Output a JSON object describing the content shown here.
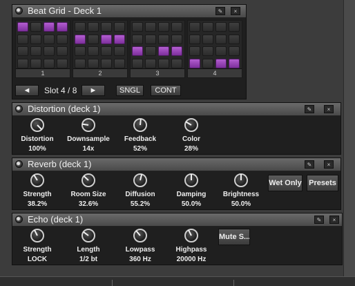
{
  "beat_grid": {
    "title": "Beat Grid - Deck 1",
    "groups": [
      {
        "label": "1",
        "active_rows": [
          0,
          0,
          0,
          0
        ]
      },
      {
        "label": "2",
        "active_rows": [
          1,
          1,
          1,
          1
        ]
      },
      {
        "label": "3",
        "active_rows": [
          2,
          2,
          2,
          2
        ]
      },
      {
        "label": "4",
        "active_rows": [
          3,
          3,
          3,
          3
        ]
      }
    ],
    "active_cells": [
      [
        0,
        0
      ],
      [
        2,
        0
      ],
      [
        3,
        0
      ],
      [
        4,
        1
      ],
      [
        6,
        1
      ],
      [
        7,
        1
      ],
      [
        8,
        2
      ],
      [
        10,
        2
      ],
      [
        11,
        2
      ],
      [
        12,
        3
      ],
      [
        14,
        3
      ],
      [
        15,
        3
      ]
    ],
    "prev_label": "◄",
    "slot_label": "Slot 4 / 8",
    "next_label": "►",
    "sngl_label": "SNGL",
    "cont_label": "CONT"
  },
  "distortion": {
    "title": "Distortion (deck 1)",
    "knobs": [
      {
        "name": "Distortion",
        "value": "100%",
        "level": 1.0
      },
      {
        "name": "Downsample",
        "value": "14x",
        "level": 0.2
      },
      {
        "name": "Feedback",
        "value": "52%",
        "level": 0.52
      },
      {
        "name": "Color",
        "value": "28%",
        "level": 0.28
      }
    ]
  },
  "reverb": {
    "title": "Reverb (deck 1)",
    "knobs": [
      {
        "name": "Strength",
        "value": "38.2%",
        "level": 0.382
      },
      {
        "name": "Room Size",
        "value": "32.6%",
        "level": 0.326
      },
      {
        "name": "Diffusion",
        "value": "55.2%",
        "level": 0.552
      },
      {
        "name": "Damping",
        "value": "50.0%",
        "level": 0.5
      },
      {
        "name": "Brightness",
        "value": "50.0%",
        "level": 0.5
      }
    ],
    "wet_only_label": "Wet Only",
    "presets_label": "Presets"
  },
  "echo": {
    "title": "Echo (deck 1)",
    "knobs": [
      {
        "name": "Strength",
        "value": "LOCK",
        "level": 0.4
      },
      {
        "name": "Length",
        "value": "1/2 bt",
        "level": 0.3
      },
      {
        "name": "Lowpass",
        "value": "360 Hz",
        "level": 0.35
      },
      {
        "name": "Highpass",
        "value": "20000 Hz",
        "level": 0.4
      }
    ],
    "mute_label": "Mute S..."
  },
  "header_buttons": {
    "edit_label": "✎",
    "close_label": "×"
  }
}
